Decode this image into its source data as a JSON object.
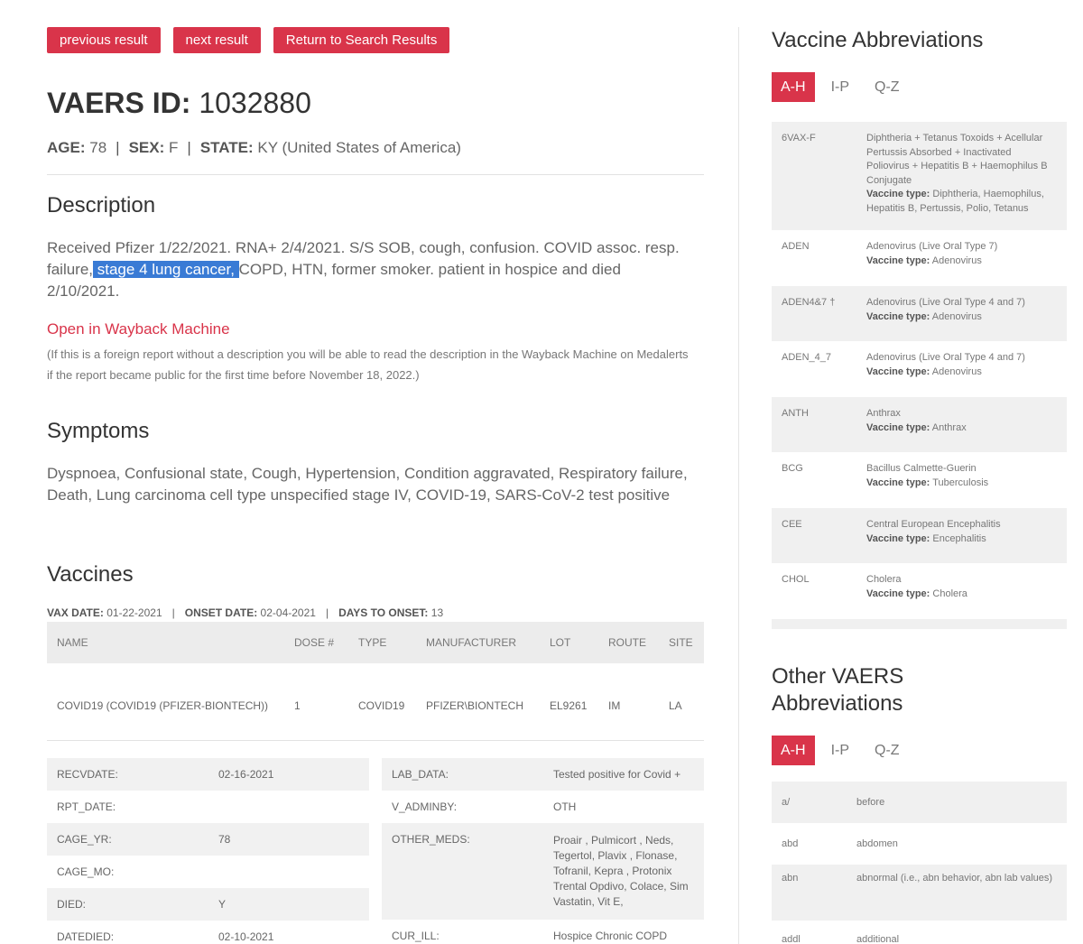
{
  "nav": {
    "previous": "previous result",
    "next": "next result",
    "back": "Return to Search Results"
  },
  "report": {
    "id_label": "VAERS ID:",
    "id": "1032880",
    "age_label": "AGE:",
    "age": "78",
    "sex_label": "SEX:",
    "sex": "F",
    "state_label": "STATE:",
    "state": "KY (United States of America)",
    "separator": "|"
  },
  "description": {
    "heading": "Description",
    "text_before": "Received Pfizer 1/22/2021. RNA+ 2/4/2021. S/S SOB, cough, confusion. COVID assoc. resp. failure,",
    "text_highlight": " stage 4 lung cancer, ",
    "text_after": "COPD, HTN, former smoker. patient in hospice and died 2/10/2021.",
    "wayback_link": "Open in Wayback Machine",
    "wayback_note": "(If this is a foreign report without a description you will be able to read the description in the Wayback Machine on Medalerts if the report became public for the first time before November 18, 2022.)"
  },
  "symptoms": {
    "heading": "Symptoms",
    "text": "Dyspnoea, Confusional state, Cough, Hypertension, Condition aggravated, Respiratory failure, Death, Lung carcinoma cell type unspecified stage IV, COVID-19, SARS-CoV-2 test positive"
  },
  "vaccines": {
    "heading": "Vaccines",
    "vax_date_label": "VAX DATE:",
    "vax_date": "01-22-2021",
    "onset_label": "ONSET DATE:",
    "onset_date": "02-04-2021",
    "days_label": "DAYS TO ONSET:",
    "days": "13",
    "separator": "|",
    "columns": [
      "NAME",
      "DOSE #",
      "TYPE",
      "MANUFACTURER",
      "LOT",
      "ROUTE",
      "SITE"
    ],
    "row": [
      "COVID19 (COVID19 (PFIZER-BIONTECH))",
      "1",
      "COVID19",
      "PFIZER\\BIONTECH",
      "EL9261",
      "IM",
      "LA"
    ]
  },
  "details_left": [
    {
      "key": "RECVDATE:",
      "value": "02-16-2021"
    },
    {
      "key": "RPT_DATE:",
      "value": ""
    },
    {
      "key": "CAGE_YR:",
      "value": "78"
    },
    {
      "key": "CAGE_MO:",
      "value": ""
    },
    {
      "key": "DIED:",
      "value": "Y"
    },
    {
      "key": "DATEDIED:",
      "value": "02-10-2021"
    }
  ],
  "details_right": [
    {
      "key": "LAB_DATA:",
      "value": "Tested positive for Covid +"
    },
    {
      "key": "V_ADMINBY:",
      "value": "OTH"
    },
    {
      "key": "OTHER_MEDS:",
      "value": "Proair , Pulmicort , Neds, Tegertol, Plavix , Flonase, Tofranil, Kepra , Protonix Trental Opdivo, Colace, Sim Vastatin, Vit E,"
    },
    {
      "key": "CUR_ILL:",
      "value": "Hospice Chronic COPD"
    }
  ],
  "sidebar": {
    "vaccine_heading": "Vaccine Abbreviations",
    "other_heading": "Other VAERS Abbreviations",
    "tabs": [
      "A-H",
      "I-P",
      "Q-Z"
    ],
    "type_label": "Vaccine type:",
    "vaccines": [
      {
        "abbr": "6VAX-F",
        "name": "Diphtheria + Tetanus Toxoids + Acellular Pertussis Absorbed + Inactivated Poliovirus + Hepatitis B + Haemophilus B Conjugate",
        "type": "Diphtheria, Haemophilus, Hepatitis B, Pertussis, Polio, Tetanus"
      },
      {
        "abbr": "ADEN",
        "name": "Adenovirus (Live Oral Type 7)",
        "type": "Adenovirus"
      },
      {
        "abbr": "ADEN4&7 †",
        "name": "Adenovirus (Live Oral Type 4 and 7)",
        "type": "Adenovirus"
      },
      {
        "abbr": "ADEN_4_7",
        "name": "Adenovirus (Live Oral Type 4 and 7)",
        "type": "Adenovirus"
      },
      {
        "abbr": "ANTH",
        "name": "Anthrax",
        "type": "Anthrax"
      },
      {
        "abbr": "BCG",
        "name": "Bacillus Calmette-Guerin",
        "type": "Tuberculosis"
      },
      {
        "abbr": "CEE",
        "name": "Central European Encephalitis",
        "type": "Encephalitis"
      },
      {
        "abbr": "CHOL",
        "name": "Cholera",
        "type": "Cholera"
      }
    ],
    "other": [
      {
        "abbr": "a/",
        "def": "before"
      },
      {
        "abbr": "abd",
        "def": "abdomen"
      },
      {
        "abbr": "abn",
        "def": "abnormal (i.e., abn behavior, abn lab values)"
      },
      {
        "abbr": "addl",
        "def": "additional"
      }
    ]
  },
  "colors": {
    "accent": "#d9344a",
    "highlight": "#3a7bd5",
    "row_gray": "#f0f0f0"
  }
}
